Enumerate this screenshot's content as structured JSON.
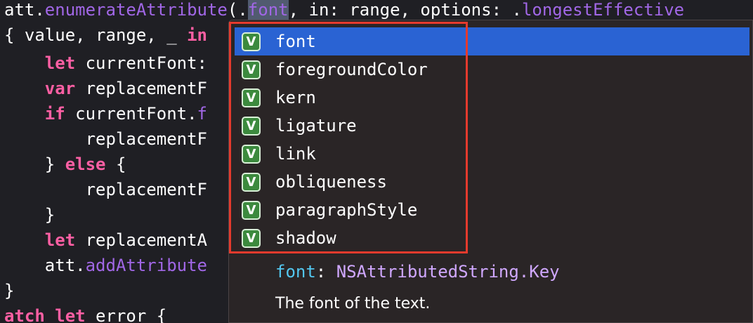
{
  "editor": {
    "lines": [
      [
        {
          "t": "att.",
          "c": "tok-id"
        },
        {
          "t": "enumerateAttribute",
          "c": "tok-fn"
        },
        {
          "t": "(.",
          "c": "tok-plain"
        },
        {
          "t": "font",
          "c": "tok-sel"
        },
        {
          "t": ", in: range, options: .",
          "c": "tok-plain"
        },
        {
          "t": "longestEffective",
          "c": "tok-fn"
        }
      ],
      [
        {
          "t": "{ value, range, _ ",
          "c": "tok-plain"
        },
        {
          "t": "in",
          "c": "tok-kw"
        }
      ],
      [
        {
          "t": "    ",
          "c": "tok-plain"
        },
        {
          "t": "let",
          "c": "tok-kw"
        },
        {
          "t": " currentFont:",
          "c": "tok-plain"
        }
      ],
      [
        {
          "t": "    ",
          "c": "tok-plain"
        },
        {
          "t": "var",
          "c": "tok-kw"
        },
        {
          "t": " replacementF",
          "c": "tok-plain"
        }
      ],
      [
        {
          "t": "    ",
          "c": "tok-plain"
        },
        {
          "t": "if",
          "c": "tok-kw"
        },
        {
          "t": " currentFont.",
          "c": "tok-plain"
        },
        {
          "t": "f",
          "c": "tok-fn"
        }
      ],
      [
        {
          "t": "        replacementF",
          "c": "tok-plain"
        }
      ],
      [
        {
          "t": "    } ",
          "c": "tok-plain"
        },
        {
          "t": "else",
          "c": "tok-kw"
        },
        {
          "t": " {",
          "c": "tok-plain"
        }
      ],
      [
        {
          "t": "        replacementF",
          "c": "tok-plain"
        }
      ],
      [
        {
          "t": "    }",
          "c": "tok-plain"
        }
      ],
      [
        {
          "t": "    ",
          "c": "tok-plain"
        },
        {
          "t": "let",
          "c": "tok-kw"
        },
        {
          "t": " replacementA",
          "c": "tok-plain"
        }
      ],
      [
        {
          "t": "    att.",
          "c": "tok-plain"
        },
        {
          "t": "addAttribute",
          "c": "tok-fn"
        }
      ],
      [
        {
          "t": "}",
          "c": "tok-plain"
        }
      ],
      [
        {
          "t": "atch",
          "c": "tok-kw"
        },
        {
          "t": " ",
          "c": "tok-plain"
        },
        {
          "t": "let",
          "c": "tok-kw"
        },
        {
          "t": " error {",
          "c": "tok-plain"
        }
      ]
    ]
  },
  "autocomplete": {
    "badge_letter": "V",
    "selected_index": 0,
    "items": [
      "font",
      "foregroundColor",
      "kern",
      "ligature",
      "link",
      "obliqueness",
      "paragraphStyle",
      "shadow"
    ],
    "doc": {
      "name": "font",
      "separator": ": ",
      "type": "NSAttributedString.Key",
      "summary": "The font of the text."
    }
  },
  "colors": {
    "highlight_frame": "#e53a2d",
    "selection": "#2a63d3",
    "keyword": "#fc5fa3",
    "function": "#a167e6"
  }
}
